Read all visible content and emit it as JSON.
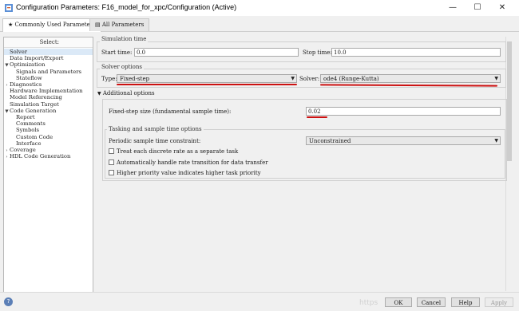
{
  "window": {
    "title": "Configuration Parameters: F16_model_for_xpc/Configuration (Active)",
    "minimize": "—",
    "maximize": "☐",
    "close": "✕"
  },
  "tabs": [
    {
      "label": "Commonly Used Parameters",
      "icon": "star-icon",
      "active": true
    },
    {
      "label": "All Parameters",
      "icon": "grid-icon",
      "active": false
    }
  ],
  "tree": {
    "header": "Select:",
    "items": [
      {
        "label": "Solver",
        "level": 0,
        "twisty": "",
        "selected": true
      },
      {
        "label": "Data Import/Export",
        "level": 0,
        "twisty": ""
      },
      {
        "label": "Optimization",
        "level": 0,
        "twisty": "▼"
      },
      {
        "label": "Signals and Parameters",
        "level": 2,
        "twisty": ""
      },
      {
        "label": "Stateflow",
        "level": 2,
        "twisty": ""
      },
      {
        "label": "Diagnostics",
        "level": 0,
        "twisty": "›"
      },
      {
        "label": "Hardware Implementation",
        "level": 0,
        "twisty": ""
      },
      {
        "label": "Model Referencing",
        "level": 0,
        "twisty": ""
      },
      {
        "label": "Simulation Target",
        "level": 0,
        "twisty": ""
      },
      {
        "label": "Code Generation",
        "level": 0,
        "twisty": "▼"
      },
      {
        "label": "Report",
        "level": 2,
        "twisty": ""
      },
      {
        "label": "Comments",
        "level": 2,
        "twisty": ""
      },
      {
        "label": "Symbols",
        "level": 2,
        "twisty": ""
      },
      {
        "label": "Custom Code",
        "level": 2,
        "twisty": ""
      },
      {
        "label": "Interface",
        "level": 2,
        "twisty": ""
      },
      {
        "label": "Coverage",
        "level": 0,
        "twisty": "›"
      },
      {
        "label": "HDL Code Generation",
        "level": 0,
        "twisty": "›"
      }
    ]
  },
  "simulation_time": {
    "title": "Simulation time",
    "start_label": "Start time:",
    "start_value": "0.0",
    "stop_label": "Stop time:",
    "stop_value": "10.0"
  },
  "solver_options": {
    "title": "Solver options",
    "type_label": "Type:",
    "type_value": "Fixed-step",
    "solver_label": "Solver:",
    "solver_value": "ode4 (Runge-Kutta)"
  },
  "additional_options": {
    "title": "Additional options",
    "step_label": "Fixed-step size (fundamental sample time):",
    "step_value": "0.02"
  },
  "tasking": {
    "title": "Tasking and sample time options",
    "periodic_label": "Periodic sample time constraint:",
    "periodic_value": "Unconstrained",
    "options": [
      {
        "label": "Treat each discrete rate as a separate task",
        "checked": false
      },
      {
        "label": "Automatically handle rate transition for data transfer",
        "checked": false
      },
      {
        "label": "Higher priority value indicates higher task priority",
        "checked": false
      }
    ]
  },
  "buttons": {
    "ok": "OK",
    "cancel": "Cancel",
    "help": "Help",
    "apply": "Apply"
  },
  "watermark": "https",
  "help_icon_glyph": "?",
  "annotation_color": "#cc1111"
}
